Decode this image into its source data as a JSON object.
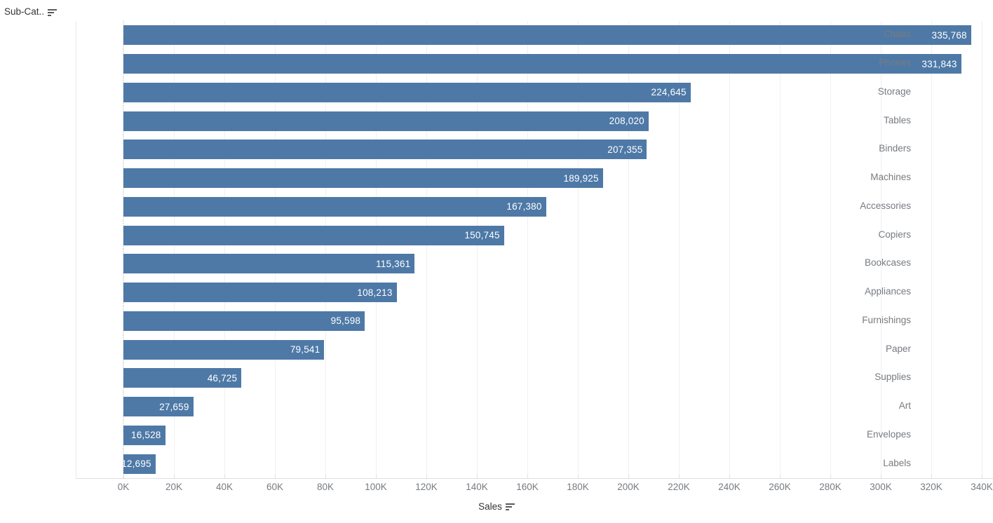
{
  "row_header": {
    "label": "Sub-Cat..",
    "sort_icon": "sort-descending-icon"
  },
  "axis": {
    "title": "Sales",
    "sort_icon": "sort-descending-icon",
    "ticks": [
      "0K",
      "20K",
      "40K",
      "60K",
      "80K",
      "100K",
      "120K",
      "140K",
      "160K",
      "180K",
      "200K",
      "220K",
      "240K",
      "260K",
      "280K",
      "300K",
      "320K",
      "340K"
    ]
  },
  "colors": {
    "bar": "#4e79a7",
    "label_text": "#777b80",
    "header_text": "#333333",
    "gridline": "#f0f0f0",
    "value_text": "#ffffff",
    "background": "#ffffff"
  },
  "chart_data": {
    "type": "bar",
    "orientation": "horizontal",
    "title": "",
    "xlabel": "Sales",
    "ylabel": "Sub-Cat..",
    "xlim": [
      0,
      345000
    ],
    "grid": true,
    "legend": "none",
    "sorted": "descending",
    "categories": [
      "Chairs",
      "Phones",
      "Storage",
      "Tables",
      "Binders",
      "Machines",
      "Accessories",
      "Copiers",
      "Bookcases",
      "Appliances",
      "Furnishings",
      "Paper",
      "Supplies",
      "Art",
      "Envelopes",
      "Labels"
    ],
    "values": [
      335768,
      331843,
      224645,
      208020,
      207355,
      189925,
      167380,
      150745,
      115361,
      108213,
      95598,
      79541,
      46725,
      27659,
      16528,
      12695
    ],
    "value_labels": [
      "335,768",
      "331,843",
      "224,645",
      "208,020",
      "207,355",
      "189,925",
      "167,380",
      "150,745",
      "115,361",
      "108,213",
      "95,598",
      "79,541",
      "46,725",
      "27,659",
      "16,528",
      "12,695"
    ],
    "tick_values": [
      0,
      20000,
      40000,
      60000,
      80000,
      100000,
      120000,
      140000,
      160000,
      180000,
      200000,
      220000,
      240000,
      260000,
      280000,
      300000,
      320000,
      340000
    ],
    "tick_labels": [
      "0K",
      "20K",
      "40K",
      "60K",
      "80K",
      "100K",
      "120K",
      "140K",
      "160K",
      "180K",
      "200K",
      "220K",
      "240K",
      "260K",
      "280K",
      "300K",
      "320K",
      "340K"
    ]
  }
}
